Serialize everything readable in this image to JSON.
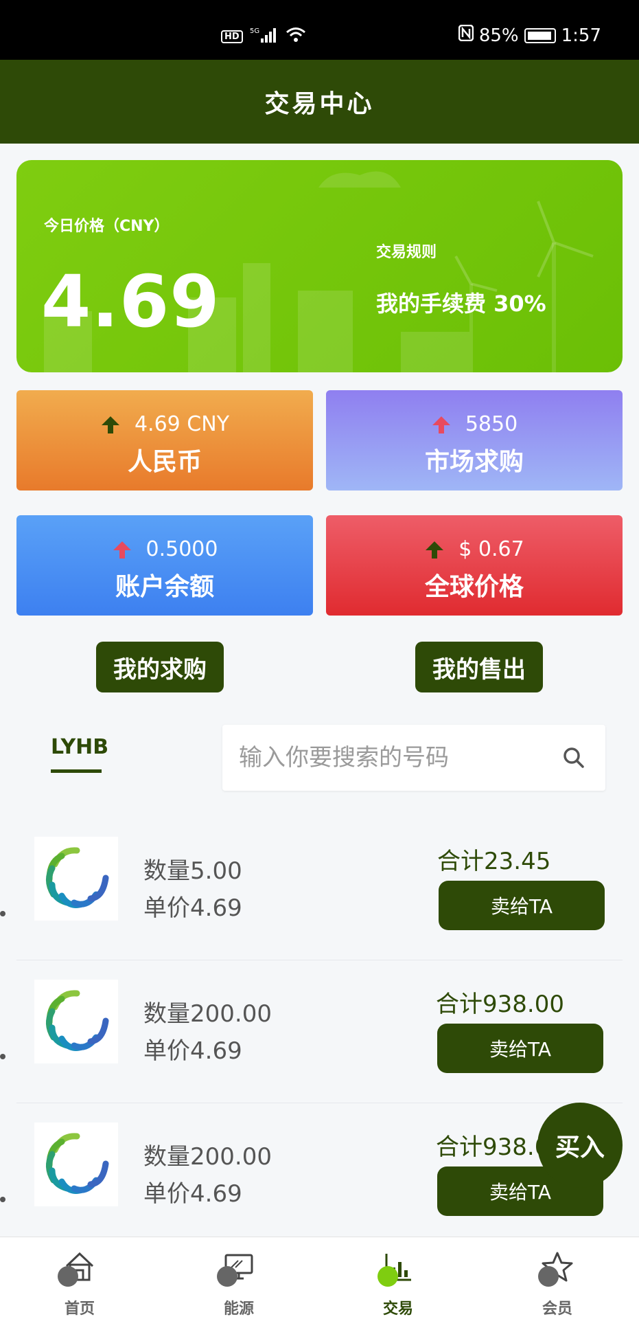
{
  "statusbar": {
    "network": "5G",
    "hd": "HD",
    "battery_pct": "85%",
    "time": "1:57"
  },
  "header": {
    "title": "交易中心"
  },
  "price_card": {
    "today_label": "今日价格（CNY）",
    "price": "4.69",
    "rules_label": "交易规则",
    "fee_text": "我的手续费 30%"
  },
  "stats": [
    {
      "value": "4.69 CNY",
      "label": "人民币",
      "trend": "up",
      "arrow_color": "#2e4a07"
    },
    {
      "value": "5850",
      "label": "市场求购",
      "trend": "up",
      "arrow_color": "#e84a5f"
    },
    {
      "value": "0.5000",
      "label": "账户余额",
      "trend": "up",
      "arrow_color": "#e84a5f"
    },
    {
      "value": "$ 0.67",
      "label": "全球价格",
      "trend": "up",
      "arrow_color": "#2e4a07"
    }
  ],
  "actions": {
    "my_buy": "我的求购",
    "my_sell": "我的售出"
  },
  "tabs": {
    "active": "LYHB"
  },
  "search": {
    "placeholder": "输入你要搜索的号码"
  },
  "listings": [
    {
      "qty": "数量5.00",
      "unit_price": "单价4.69",
      "total": "合计23.45",
      "button": "卖给TA"
    },
    {
      "qty": "数量200.00",
      "unit_price": "单价4.69",
      "total": "合计938.00",
      "button": "卖给TA"
    },
    {
      "qty": "数量200.00",
      "unit_price": "单价4.69",
      "total": "合计938.00",
      "button": "卖给TA"
    }
  ],
  "fab": {
    "label": "买入"
  },
  "nav": [
    {
      "label": "首页",
      "icon": "home-icon"
    },
    {
      "label": "能源",
      "icon": "monitor-icon"
    },
    {
      "label": "交易",
      "icon": "chart-icon",
      "active": true
    },
    {
      "label": "会员",
      "icon": "star-icon"
    }
  ]
}
